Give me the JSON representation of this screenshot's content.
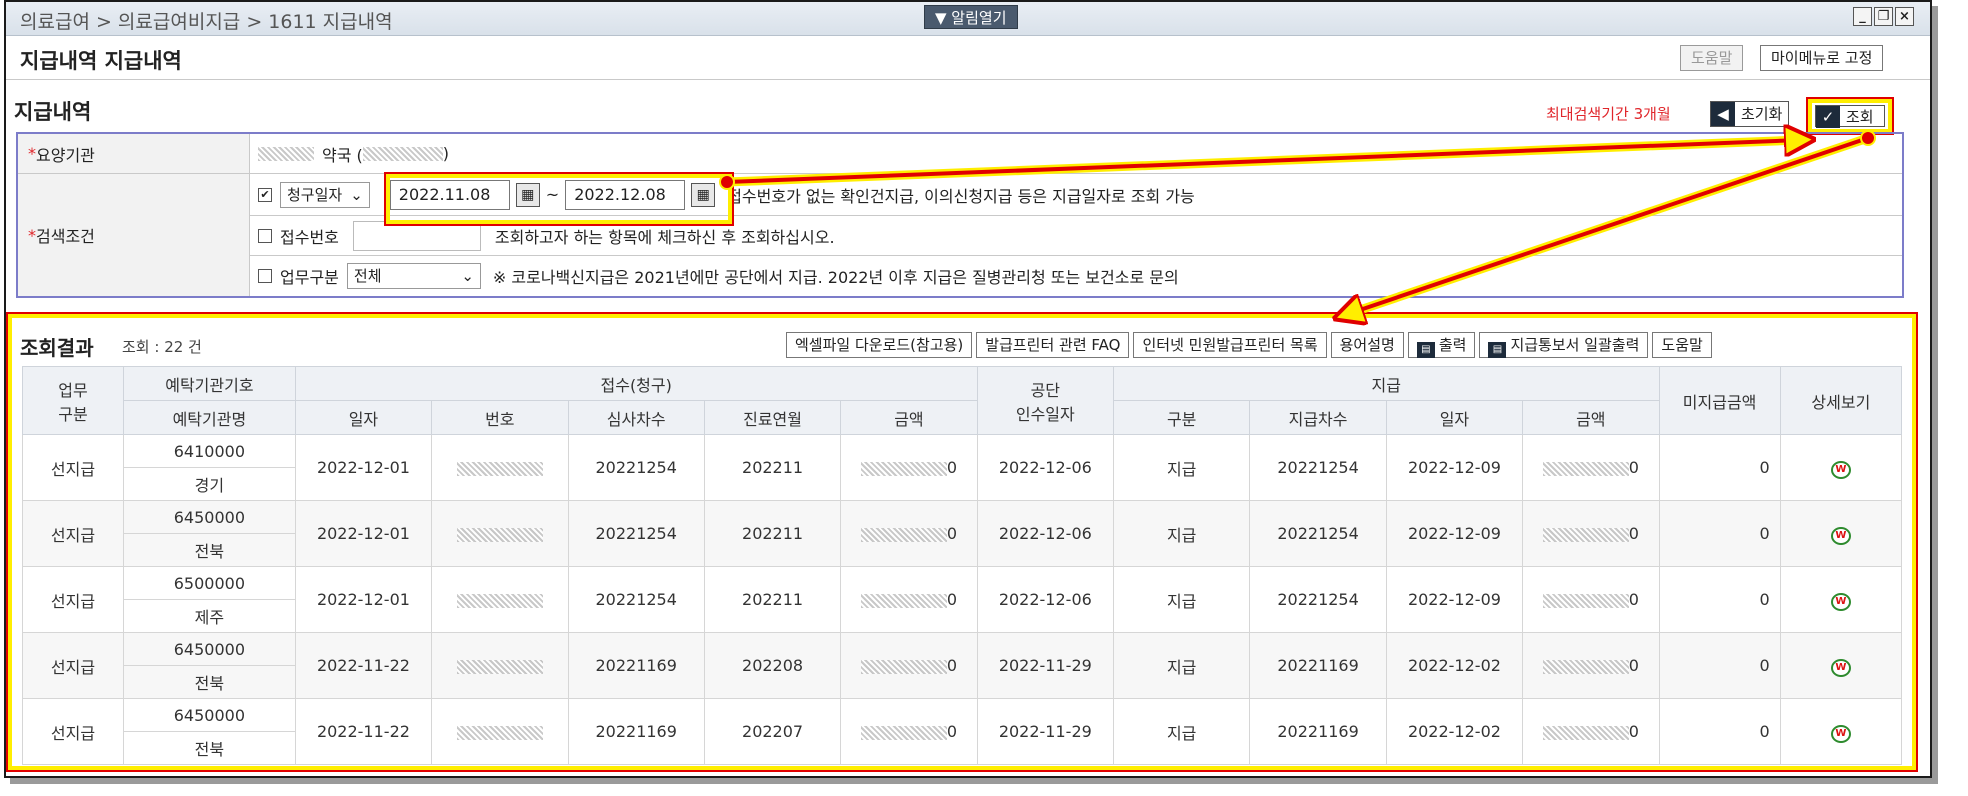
{
  "window": {
    "breadcrumb": "의료급여 > 의료급여비지급 > 1611 지급내역",
    "alarm_button": "▼ 알림열기",
    "ctl_min": "_",
    "ctl_restore": "❐",
    "ctl_close": "×"
  },
  "page": {
    "title": "지급내역 지급내역",
    "help_label": "도움말",
    "mymenu_label": "마이메뉴로 고정"
  },
  "search": {
    "section_title": "지급내역",
    "max_period_note": "최대검색기간 3개월",
    "reset_label": "초기화",
    "reset_icon": "◀",
    "search_label": "조회",
    "search_icon": "✓",
    "req_mark": "*",
    "institution_label": "요양기관",
    "institution_value_suffix": "약국 (",
    "institution_value_close": ")",
    "condition_label": "검색조건",
    "date_type_value": "청구일자",
    "date_from": "2022.11.08",
    "date_to": "2022.12.08",
    "tilde": "~",
    "date_note": "접수번호가 없는 확인건지급, 이의신청지급 등은 지급일자로 조회 가능",
    "receipt_label": "접수번호",
    "receipt_note": "조회하고자 하는 항목에 체크하신 후 조회하십시오.",
    "biz_label": "업무구분",
    "biz_value": "전체",
    "biz_note": "※ 코로나백신지급은 2021년에만 공단에서 지급. 2022년 이후 지급은 질병관리청 또는 보건소로 문의"
  },
  "results": {
    "title": "조회결과",
    "count": "조회 : 22 건",
    "buttons": [
      "엑셀파일 다운로드(참고용)",
      "발급프린터 관련 FAQ",
      "인터넷 민원발급프린터 목록",
      "용어설명",
      "출력",
      "지급통보서 일괄출력",
      "도움말"
    ],
    "headers": {
      "biz_type": "업무\n구분",
      "agency_code": "예탁기관기호",
      "agency_name": "예탁기관명",
      "receipt": "접수(청구)",
      "r_date": "일자",
      "r_no": "번호",
      "r_review": "심사차수",
      "r_month": "진료연월",
      "r_amount": "금액",
      "takeover": "공단\n인수일자",
      "payment": "지급",
      "p_type": "구분",
      "p_round": "지급차수",
      "p_date": "일자",
      "p_amount": "금액",
      "unpaid": "미지급금액",
      "detail": "상세보기"
    },
    "rows": [
      {
        "biz": "선지급",
        "code": "6410000",
        "name": "경기",
        "r_date": "2022-12-01",
        "review": "20221254",
        "month": "202211",
        "r_amt_tail": "0",
        "takeover": "2022-12-06",
        "p_type": "지급",
        "p_round": "20221254",
        "p_date": "2022-12-09",
        "p_amt_tail": "0",
        "unpaid": "0"
      },
      {
        "biz": "선지급",
        "code": "6450000",
        "name": "전북",
        "r_date": "2022-12-01",
        "review": "20221254",
        "month": "202211",
        "r_amt_tail": "0",
        "takeover": "2022-12-06",
        "p_type": "지급",
        "p_round": "20221254",
        "p_date": "2022-12-09",
        "p_amt_tail": "0",
        "unpaid": "0"
      },
      {
        "biz": "선지급",
        "code": "6500000",
        "name": "제주",
        "r_date": "2022-12-01",
        "review": "20221254",
        "month": "202211",
        "r_amt_tail": "0",
        "takeover": "2022-12-06",
        "p_type": "지급",
        "p_round": "20221254",
        "p_date": "2022-12-09",
        "p_amt_tail": "0",
        "unpaid": "0"
      },
      {
        "biz": "선지급",
        "code": "6450000",
        "name": "전북",
        "r_date": "2022-11-22",
        "review": "20221169",
        "month": "202208",
        "r_amt_tail": "0",
        "takeover": "2022-11-29",
        "p_type": "지급",
        "p_round": "20221169",
        "p_date": "2022-12-02",
        "p_amt_tail": "0",
        "unpaid": "0"
      },
      {
        "biz": "선지급",
        "code": "6450000",
        "name": "전북",
        "r_date": "2022-11-22",
        "review": "20221169",
        "month": "202207",
        "r_amt_tail": "0",
        "takeover": "2022-11-29",
        "p_type": "지급",
        "p_round": "20221169",
        "p_date": "2022-12-02",
        "p_amt_tail": "0",
        "unpaid": "0"
      }
    ],
    "detail_icon_text": "W"
  },
  "colors": {
    "highlight_border": "#ffee00",
    "highlight_outline": "#e00000",
    "arrow": "#e00000",
    "required": "#e0262b"
  }
}
